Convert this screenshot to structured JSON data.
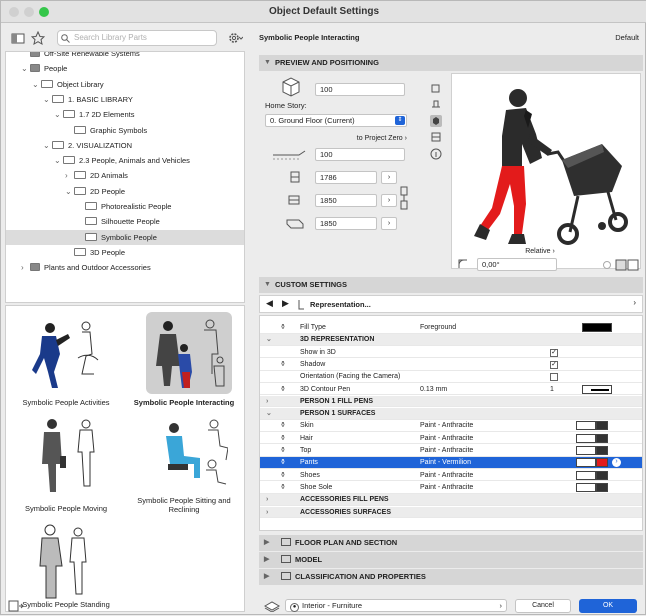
{
  "window": {
    "title": "Object Default Settings"
  },
  "search": {
    "placeholder": "Search Library Parts"
  },
  "tree": [
    {
      "label": "Off-Site Renewable Systems",
      "indent": 1,
      "chev": "",
      "folder": false
    },
    {
      "label": "People",
      "indent": 1,
      "chev": "⌄",
      "folder": false
    },
    {
      "label": "Object Library",
      "indent": 2,
      "chev": "⌄",
      "folder": true
    },
    {
      "label": "1. BASIC LIBRARY",
      "indent": 3,
      "chev": "⌄",
      "folder": true
    },
    {
      "label": "1.7 2D Elements",
      "indent": 4,
      "chev": "⌄",
      "folder": true
    },
    {
      "label": "Graphic Symbols",
      "indent": 5,
      "chev": "",
      "folder": true
    },
    {
      "label": "2. VISUALIZATION",
      "indent": 3,
      "chev": "⌄",
      "folder": true
    },
    {
      "label": "2.3 People, Animals and Vehicles",
      "indent": 4,
      "chev": "⌄",
      "folder": true
    },
    {
      "label": "2D Animals",
      "indent": 5,
      "chev": "›",
      "folder": true
    },
    {
      "label": "2D People",
      "indent": 5,
      "chev": "⌄",
      "folder": true
    },
    {
      "label": "Photorealistic People",
      "indent": 6,
      "chev": "",
      "folder": true
    },
    {
      "label": "Silhouette People",
      "indent": 6,
      "chev": "",
      "folder": true
    },
    {
      "label": "Symbolic People",
      "indent": 6,
      "chev": "",
      "folder": true,
      "selected": true
    },
    {
      "label": "3D People",
      "indent": 5,
      "chev": "",
      "folder": true
    },
    {
      "label": "Plants and Outdoor Accessories",
      "indent": 1,
      "chev": "›",
      "folder": false
    }
  ],
  "thumbs": [
    {
      "label": "Symbolic People Activities"
    },
    {
      "label": "Symbolic People Interacting",
      "selected": true
    },
    {
      "label": "Symbolic People Moving"
    },
    {
      "label": "Symbolic People Sitting and Reclining"
    },
    {
      "label": "Symbolic People Standing"
    }
  ],
  "header": {
    "object_name": "Symbolic People Interacting",
    "default_label": "Default"
  },
  "preview": {
    "section": "PREVIEW AND POSITIONING",
    "elevation": "100",
    "home_story_label": "Home Story:",
    "home_story": "0. Ground Floor (Current)",
    "to_project_zero": "to Project Zero",
    "offset": "100",
    "width": "1786",
    "depth": "1850",
    "height": "1850",
    "relative": "Relative",
    "angle": "0,00°"
  },
  "custom": {
    "section": "CUSTOM SETTINGS",
    "representation": "Representation..."
  },
  "params": [
    {
      "name": "Fill Type",
      "value": "Foreground",
      "kind": "swatch-black",
      "icon": true
    },
    {
      "name": "3D REPRESENTATION",
      "kind": "header",
      "toggle": "⌄"
    },
    {
      "name": "Show in 3D",
      "kind": "checked"
    },
    {
      "name": "Shadow",
      "kind": "checked",
      "icon": true
    },
    {
      "name": "Orientation (Facing the Camera)",
      "kind": "unchecked"
    },
    {
      "name": "3D Contour Pen",
      "value": "0.13 mm",
      "pen": "1",
      "kind": "pen",
      "icon": true
    },
    {
      "name": "PERSON 1 FILL PENS",
      "kind": "header",
      "toggle": "›"
    },
    {
      "name": "PERSON 1 SURFACES",
      "kind": "header",
      "toggle": "⌄"
    },
    {
      "name": "Skin",
      "value": "Paint - Anthracite",
      "kind": "surface",
      "icon": true
    },
    {
      "name": "Hair",
      "value": "Paint - Anthracite",
      "kind": "surface",
      "icon": true
    },
    {
      "name": "Top",
      "value": "Paint - Anthracite",
      "kind": "surface",
      "icon": true
    },
    {
      "name": "Pants",
      "value": "Paint - Vermilion",
      "kind": "surface-red",
      "icon": true,
      "selected": true
    },
    {
      "name": "Shoes",
      "value": "Paint - Anthracite",
      "kind": "surface",
      "icon": true
    },
    {
      "name": "Shoe Sole",
      "value": "Paint - Anthracite",
      "kind": "surface",
      "icon": true
    },
    {
      "name": "ACCESSORIES FILL PENS",
      "kind": "header",
      "toggle": "›"
    },
    {
      "name": "ACCESSORIES SURFACES",
      "kind": "header",
      "toggle": "›"
    }
  ],
  "sections": [
    "FLOOR PLAN AND SECTION",
    "MODEL",
    "CLASSIFICATION AND PROPERTIES"
  ],
  "footer": {
    "layer": "Interior - Furniture",
    "cancel": "Cancel",
    "ok": "OK"
  },
  "colors": {
    "accent": "#1f64d8",
    "pants": "#e31b1b",
    "anthracite": "#333333"
  }
}
